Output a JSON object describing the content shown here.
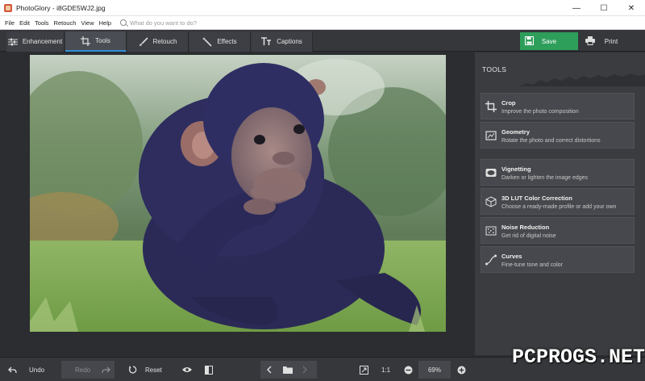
{
  "window": {
    "title": "PhotoGlory - i8GDE5WJ2.jpg",
    "minimize_glyph": "—",
    "maximize_glyph": "☐",
    "close_glyph": "✕"
  },
  "menu": {
    "items": [
      "File",
      "Edit",
      "Tools",
      "Retouch",
      "View",
      "Help"
    ],
    "search_placeholder": "What do you want to do?"
  },
  "toolbar": {
    "tabs": [
      {
        "label": "Enhancement",
        "icon": "sliders-icon"
      },
      {
        "label": "Tools",
        "icon": "crop-icon",
        "active": true
      },
      {
        "label": "Retouch",
        "icon": "brush-icon"
      },
      {
        "label": "Effects",
        "icon": "magic-wand-icon"
      },
      {
        "label": "Captions",
        "icon": "text-icon"
      }
    ],
    "save_label": "Save",
    "print_label": "Print"
  },
  "panel": {
    "title": "TOOLS",
    "tools": [
      {
        "name": "Crop",
        "desc": "Improve the photo composition",
        "icon": "crop-icon"
      },
      {
        "name": "Geometry",
        "desc": "Rotate the photo and correct distortions",
        "icon": "geometry-icon"
      },
      {
        "name": "Vignetting",
        "desc": "Darken or lighten the image edges",
        "icon": "vignette-icon"
      },
      {
        "name": "3D LUT Color Correction",
        "desc": "Choose a ready-made profile or add your own",
        "icon": "cube-icon"
      },
      {
        "name": "Noise Reduction",
        "desc": "Get rid of digital noise",
        "icon": "noise-icon"
      },
      {
        "name": "Curves",
        "desc": "Fine-tune tone and color",
        "icon": "curves-icon"
      }
    ]
  },
  "bottombar": {
    "undo_label": "Undo",
    "redo_label": "Redo",
    "reset_label": "Reset",
    "one_to_one_label": "1:1",
    "zoom_value": "69%"
  },
  "watermark": "PCPROGS.NET",
  "colors": {
    "accent": "#2e9e5b",
    "active_tab_underline": "#2f8fd8"
  }
}
